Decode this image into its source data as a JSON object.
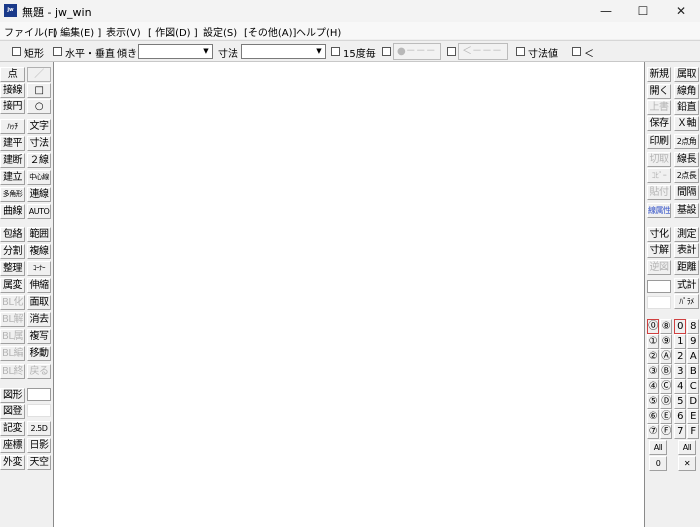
{
  "title": {
    "app_icon_text": "jw",
    "text": "無題 - jw_win",
    "minimize": "—",
    "maximize": "☐",
    "close": "✕"
  },
  "menu": [
    "ファイル(F)",
    "[ 編集(E) ]",
    "表示(V)",
    "[ 作図(D) ]",
    "設定(S)",
    "[その他(A)]",
    "ヘルプ(H)"
  ],
  "toolbar": {
    "rect": "矩形",
    "hv": "水平・垂直",
    "slope": "傾き",
    "dim": "寸法",
    "deg15": "15度毎",
    "btn1": "●－－－",
    "btn2": "＜－－－",
    "dimval": "寸法値",
    "lt": "＜"
  },
  "left_panel": [
    [
      "点",
      "／"
    ],
    [
      "接線",
      "□"
    ],
    [
      "接円",
      "○"
    ],
    [
      "ﾊｯﾁ",
      "文字"
    ],
    [
      "建平",
      "寸法"
    ],
    [
      "建断",
      "２線"
    ],
    [
      "建立",
      "中心線"
    ],
    [
      "多角形",
      "連線"
    ],
    [
      "曲線",
      "AUTO"
    ],
    [
      "包絡",
      "範囲"
    ],
    [
      "分割",
      "複線"
    ],
    [
      "整理",
      "ｺｰﾅｰ"
    ],
    [
      "属変",
      "伸縮"
    ],
    [
      "BL化",
      "面取"
    ],
    [
      "BL解",
      "消去"
    ],
    [
      "BL属",
      "複写"
    ],
    [
      "BL編",
      "移動"
    ],
    [
      "BL終",
      "戻る"
    ],
    [
      "図形",
      ""
    ],
    [
      "図登",
      ""
    ],
    [
      "記変",
      "2.5D"
    ],
    [
      "座標",
      "日影"
    ],
    [
      "外変",
      "天空"
    ]
  ],
  "right_panel": [
    [
      "新規",
      "属取"
    ],
    [
      "開く",
      "線角"
    ],
    [
      "上書",
      "鉛直"
    ],
    [
      "保存",
      "Ｘ軸"
    ],
    [
      "印刷",
      "2点角"
    ],
    [
      "切取",
      "線長"
    ],
    [
      "ｺﾋﾟｰ",
      "2点長"
    ],
    [
      "貼付",
      "間隔"
    ],
    [
      "線属性",
      "基設"
    ],
    [
      "寸化",
      "測定"
    ],
    [
      "寸解",
      "表計"
    ],
    [
      "逆図",
      "距離"
    ],
    [
      "",
      "式計"
    ],
    [
      "",
      "ﾊﾟﾗﾒ"
    ]
  ],
  "layers": {
    "left": [
      "⓪",
      "⑧",
      "①",
      "⑨",
      "②",
      "Ⓐ",
      "③",
      "Ⓑ",
      "④",
      "Ⓒ",
      "⑤",
      "Ⓓ",
      "⑥",
      "Ⓔ",
      "⑦",
      "Ⓕ"
    ],
    "right": [
      "0",
      "8",
      "1",
      "9",
      "2",
      "A",
      "3",
      "B",
      "4",
      "C",
      "5",
      "D",
      "6",
      "E",
      "7",
      "F"
    ],
    "all_left": "All",
    "all_right": "All",
    "zero": "0",
    "x": "✕"
  }
}
